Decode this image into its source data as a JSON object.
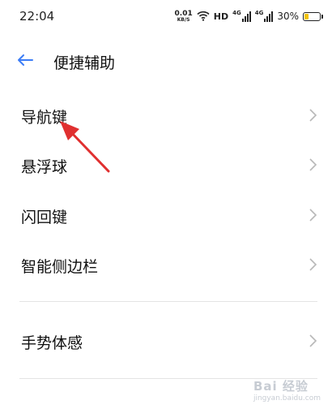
{
  "status_bar": {
    "time": "22:04",
    "net_speed_value": "0.01",
    "net_speed_unit": "KB/S",
    "hd_label": "HD",
    "sig1_gen": "4G",
    "sig2_gen": "4G",
    "battery_percent": "30%",
    "battery_level": 0.3,
    "battery_color": "#f2c200",
    "icons": [
      "wifi-icon",
      "signal-icon",
      "battery-icon"
    ]
  },
  "header": {
    "back_icon": "arrow-left-icon",
    "title": "便捷辅助",
    "accent_color": "#3b7cf6"
  },
  "menu": {
    "items": [
      {
        "label": "导航键"
      },
      {
        "label": "悬浮球"
      },
      {
        "label": "闪回键"
      },
      {
        "label": "智能侧边栏"
      },
      {
        "label": "手势体感"
      }
    ]
  },
  "annotation": {
    "arrow_color": "#e03030"
  },
  "watermark": {
    "text": "Bai 经验",
    "sub": "jingyan.baidu.com"
  }
}
